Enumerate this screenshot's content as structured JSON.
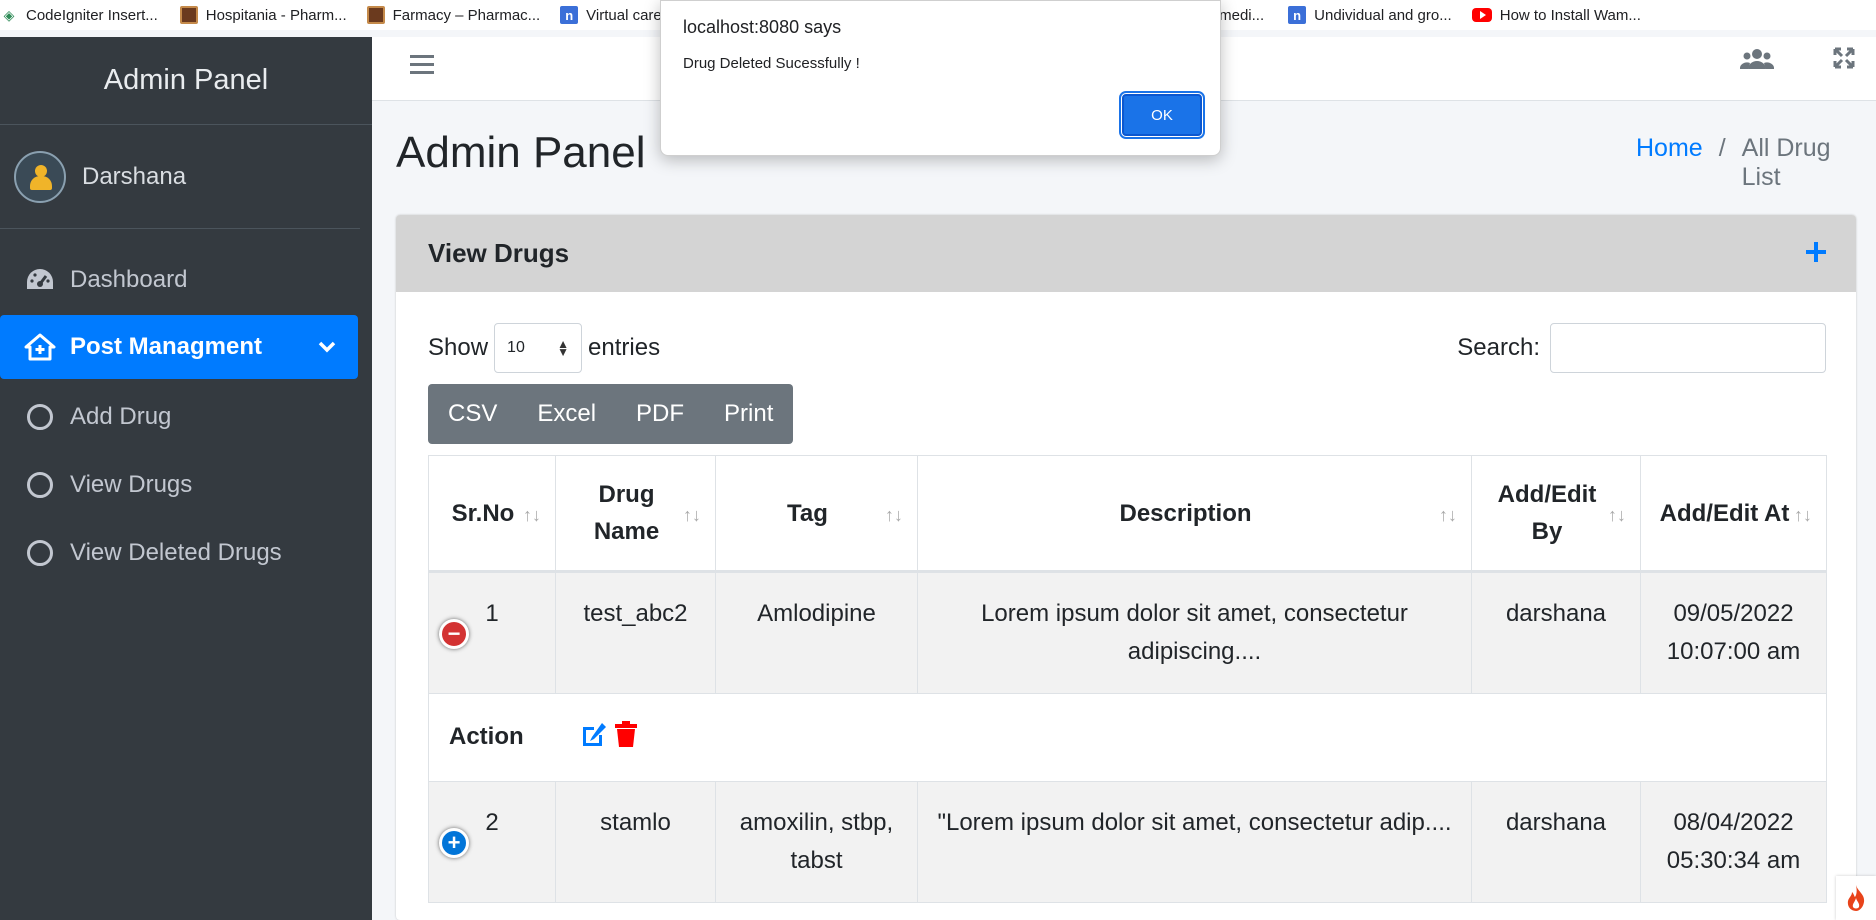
{
  "bookmarks": [
    {
      "label": "CodeIgniter Insert...",
      "icon": "codeigniter-icon"
    },
    {
      "label": "Hospitania - Pharm...",
      "icon": "pharmacy-icon"
    },
    {
      "label": "Farmacy – Pharmac...",
      "icon": "pharmacy-icon"
    },
    {
      "label": "Virtual care",
      "icon": "n-icon"
    },
    {
      "label": "ome medi...",
      "icon": "n-icon"
    },
    {
      "label": "Undividual and gro...",
      "icon": "n-icon"
    },
    {
      "label": "How to Install Wam...",
      "icon": "youtube-icon"
    }
  ],
  "dialog": {
    "title": "localhost:8080 says",
    "message": "Drug Deleted Sucessfully !",
    "ok_label": "OK"
  },
  "sidebar": {
    "brand": "Admin Panel",
    "user_name": "Darshana",
    "items": [
      {
        "label": "Dashboard",
        "icon": "tachometer-icon"
      },
      {
        "label": "Post Managment",
        "icon": "home-icon",
        "active": true
      },
      {
        "label": "Add Drug",
        "icon": "circle-icon"
      },
      {
        "label": "View Drugs",
        "icon": "circle-icon"
      },
      {
        "label": "View Deleted Drugs",
        "icon": "circle-icon"
      }
    ]
  },
  "header": {
    "title": "Admin Panel",
    "breadcrumb": [
      "Home",
      "/",
      "All Drug List"
    ]
  },
  "card": {
    "title": "View Drugs",
    "length_label_before": "Show",
    "length_value": "10",
    "length_label_after": "entries",
    "search_label": "Search:",
    "search_value": "",
    "buttons": [
      "CSV",
      "Excel",
      "PDF",
      "Print"
    ]
  },
  "table": {
    "headers": [
      "Sr.No",
      "Drug Name",
      "Tag",
      "Description",
      "Add/Edit By",
      "Add/Edit At"
    ],
    "rows": [
      {
        "sr": "1",
        "name": "test_abc2",
        "tag": "Amlodipine",
        "description": "Lorem ipsum dolor sit amet, consectetur adipiscing....",
        "by": "darshana",
        "date": "09/05/2022",
        "time": "10:07:00 am",
        "expanded": true
      },
      {
        "sr": "2",
        "name": "stamlo",
        "tag": "amoxilin, stbp, tabst",
        "description": "\"Lorem ipsum dolor sit amet, consectetur adip....",
        "by": "darshana",
        "date": "08/04/2022",
        "time": "05:30:34 am",
        "expanded": false
      }
    ],
    "action_label": "Action"
  },
  "colors": {
    "sidebar_bg": "#343a40",
    "accent": "#007bff",
    "danger": "#ff0000",
    "card_header_bg": "#d4d4d4",
    "button_group_bg": "#6c757d"
  }
}
